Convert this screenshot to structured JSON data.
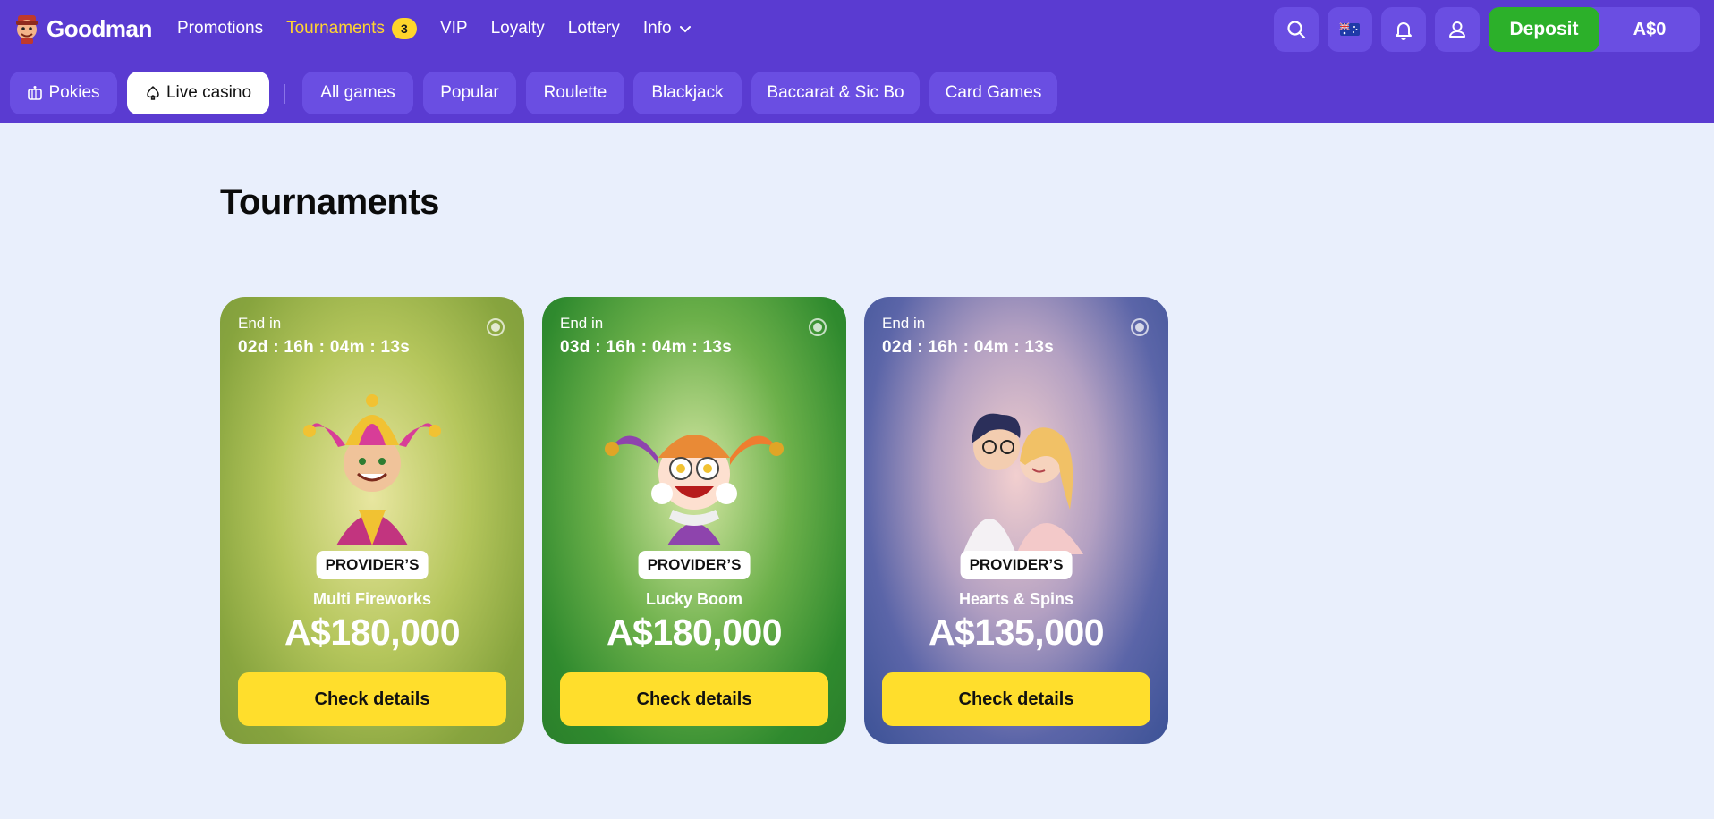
{
  "brand": {
    "name": "Goodman"
  },
  "nav": [
    {
      "label": "Promotions"
    },
    {
      "label": "Tournaments",
      "badge": "3"
    },
    {
      "label": "VIP"
    },
    {
      "label": "Loyalty"
    },
    {
      "label": "Lottery"
    },
    {
      "label": "Info"
    }
  ],
  "header": {
    "icons": [
      "search-icon",
      "australia-flag-icon",
      "bell-icon",
      "user-icon"
    ],
    "deposit_label": "Deposit",
    "balance": "A$0"
  },
  "subnav": [
    {
      "label": "Pokies",
      "icon": "slot-machine-icon"
    },
    {
      "label": "Live casino",
      "icon": "spade-icon",
      "active": true
    },
    {
      "label": "All games"
    },
    {
      "label": "Popular"
    },
    {
      "label": "Roulette"
    },
    {
      "label": "Blackjack"
    },
    {
      "label": "Baccarat & Sic Bo"
    },
    {
      "label": "Card Games"
    }
  ],
  "page": {
    "title": "Tournaments"
  },
  "tournaments": [
    {
      "end_label": "End in",
      "timer": "02d : 16h : 04m : 13s",
      "badge": "PROVIDER’S",
      "game": "Multi Fireworks",
      "prize": "A$180,000",
      "cta": "Check details",
      "art": "jester-icon"
    },
    {
      "end_label": "End in",
      "timer": "03d : 16h : 04m : 13s",
      "badge": "PROVIDER’S",
      "game": "Lucky Boom",
      "prize": "A$180,000",
      "cta": "Check details",
      "art": "clown-icon"
    },
    {
      "end_label": "End in",
      "timer": "02d : 16h : 04m : 13s",
      "badge": "PROVIDER’S",
      "game": "Hearts & Spins",
      "prize": "A$135,000",
      "cta": "Check details",
      "art": "couple-icon"
    }
  ],
  "colors": {
    "header": "#5a3bd1",
    "deposit": "#2cb02a",
    "active_nav": "#ffd430",
    "cta": "#ffde2c",
    "page_bg": "#e9effc"
  }
}
